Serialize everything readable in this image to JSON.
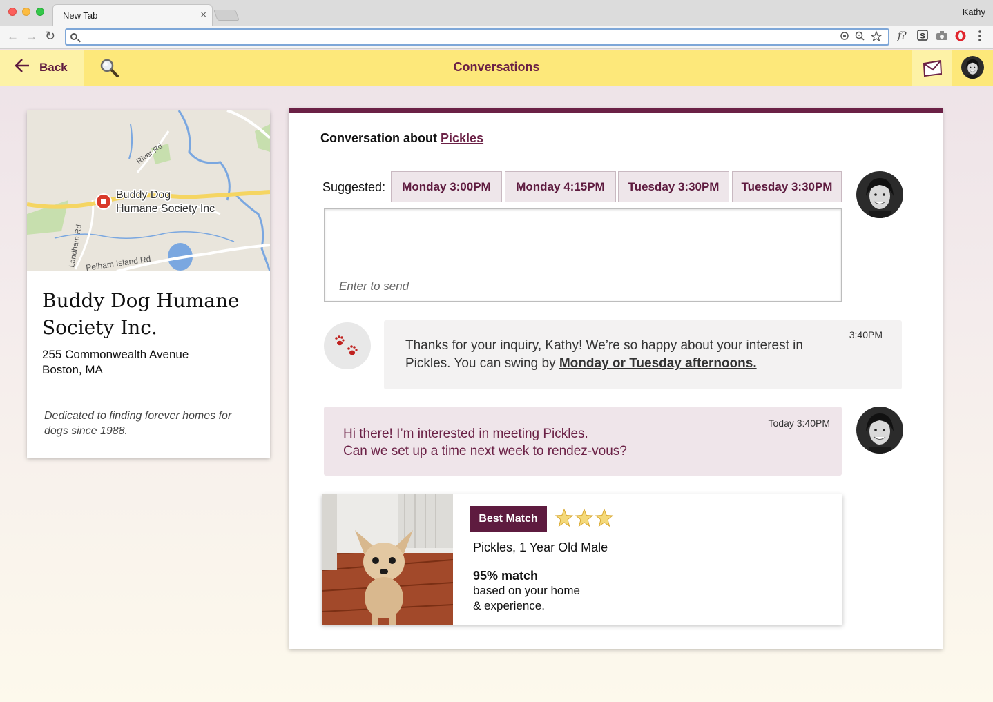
{
  "browser": {
    "tab_title": "New Tab",
    "tab_close": "×",
    "profile_name": "Kathy",
    "back_glyph": "←",
    "forward_glyph": "→",
    "reload_glyph": "↻",
    "address_value": "",
    "extensions": [
      "f?",
      "S",
      "camera-icon",
      "opera-icon",
      "menu-icon"
    ]
  },
  "header": {
    "back_label": "Back",
    "title": "Conversations",
    "colors": {
      "bar": "#fde87a",
      "accent": "#6b2146"
    }
  },
  "shelter": {
    "map_label_line1": "Buddy Dog",
    "map_label_line2": "Humane Society Inc",
    "map_roads": [
      "River Rd",
      "Landham Rd",
      "Pelham Island Rd"
    ],
    "name": "Buddy Dog Humane Society Inc.",
    "address_line1": "255 Commonwealth Avenue",
    "address_line2": "Boston, MA",
    "description": "Dedicated to finding forever homes for dogs since 1988."
  },
  "conversation": {
    "title_prefix": "Conversation about",
    "pet_link": "Pickles",
    "suggested_label": "Suggested:",
    "suggested_slots": [
      "Monday 3:00PM",
      "Monday 4:15PM",
      "Tuesday 3:30PM",
      "Tuesday 3:30PM"
    ],
    "input_hint": "Enter to send",
    "messages": [
      {
        "from": "shelter",
        "time": "3:40PM",
        "text_before": "Thanks for your inquiry, Kathy! We’re so happy about your interest in Pickles. You can swing by",
        "link_text": "Monday or Tuesday afternoons."
      },
      {
        "from": "me",
        "time": "Today 3:40PM",
        "line1": "Hi there! I’m interested in meeting Pickles.",
        "line2": "Can we set up a time next week to rendez-vous?"
      }
    ]
  },
  "pet_card": {
    "badge": "Best Match",
    "star_rating": 3,
    "description": "Pickles, 1 Year Old Male",
    "match_score": "95% match",
    "match_basis_line1": "based on your home",
    "match_basis_line2": "& experience."
  }
}
